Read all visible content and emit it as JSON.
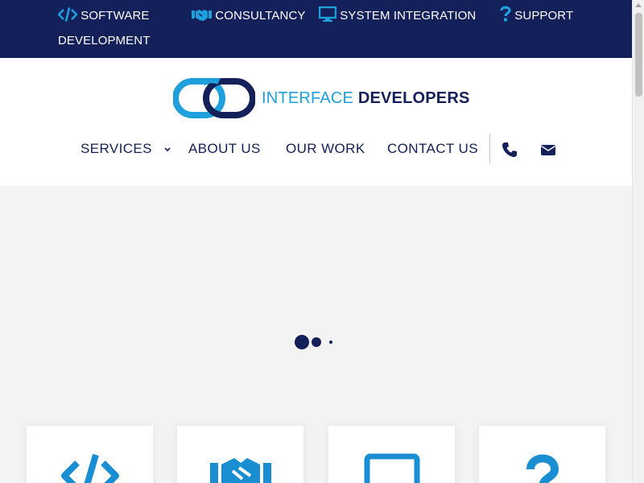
{
  "topbar": {
    "items": [
      {
        "label": "SOFTWARE DEVELOPMENT",
        "icon": "code-icon"
      },
      {
        "label": "CONSULTANCY",
        "icon": "handshake-icon"
      },
      {
        "label": "SYSTEM INTEGRATION",
        "icon": "monitor-icon"
      },
      {
        "label": "SUPPORT",
        "icon": "question-icon"
      }
    ]
  },
  "brand": {
    "name_part1": "INTERFACE",
    "name_part2": "DEVELOPERS"
  },
  "nav": {
    "services": "SERVICES",
    "about": "ABOUT US",
    "work": "OUR WORK",
    "contact": "CONTACT US"
  },
  "colors": {
    "navy": "#13205a",
    "accent_blue": "#1ea0dc",
    "icon_blue": "#1a8ed3"
  }
}
